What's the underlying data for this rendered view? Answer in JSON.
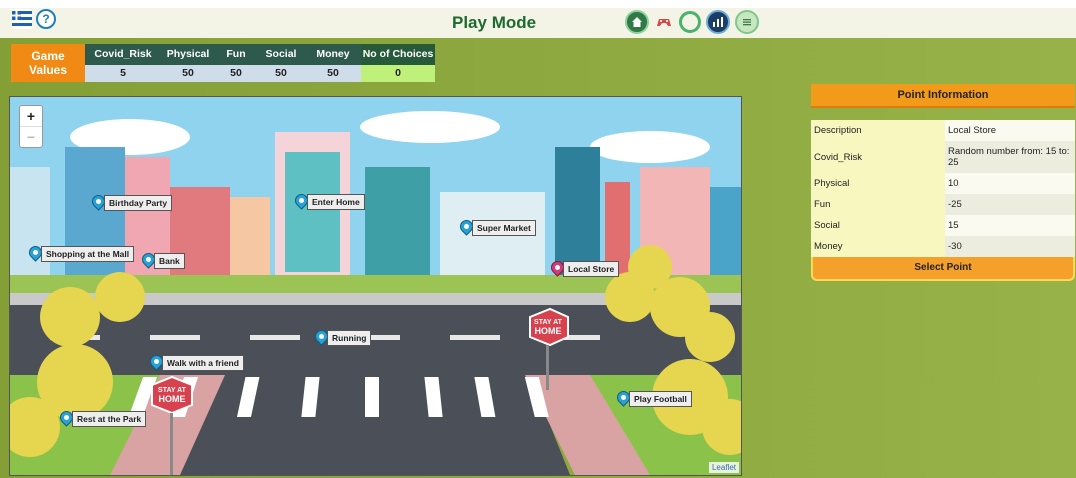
{
  "header": {
    "title": "Play Mode",
    "help_glyph": "?",
    "icons": [
      "language-icon",
      "help-icon",
      "home-icon",
      "game-icon",
      "refresh-icon",
      "stats-icon",
      "list-icon"
    ]
  },
  "game_values": {
    "label": "Game Values",
    "columns": [
      {
        "name": "Covid_Risk",
        "value": "5"
      },
      {
        "name": "Physical",
        "value": "50"
      },
      {
        "name": "Fun",
        "value": "50"
      },
      {
        "name": "Social",
        "value": "50"
      },
      {
        "name": "Money",
        "value": "50"
      },
      {
        "name": "No of Choices",
        "value": "0"
      }
    ]
  },
  "map": {
    "zoom_in": "+",
    "zoom_out": "−",
    "attribution": "Leaflet",
    "markers": [
      {
        "label": "Birthday Party"
      },
      {
        "label": "Enter Home"
      },
      {
        "label": "Super Market"
      },
      {
        "label": "Shopping at the Mall"
      },
      {
        "label": "Bank"
      },
      {
        "label": "Local Store",
        "selected": true
      },
      {
        "label": "Running"
      },
      {
        "label": "Walk with a friend"
      },
      {
        "label": "Rest at the Park"
      },
      {
        "label": "Play Football"
      }
    ],
    "signs": [
      "STAY AT",
      "HOME"
    ]
  },
  "point_info": {
    "title": "Point Information",
    "rows": [
      {
        "key": "Description",
        "value": "Local Store"
      },
      {
        "key": "Covid_Risk",
        "value": "Random number from: 15 to: 25"
      },
      {
        "key": "Physical",
        "value": "10"
      },
      {
        "key": "Fun",
        "value": "-25"
      },
      {
        "key": "Social",
        "value": "15"
      },
      {
        "key": "Money",
        "value": "-30"
      }
    ],
    "select_label": "Select Point"
  },
  "colors": {
    "accent": "#f29a1a",
    "title": "#1d6b2f",
    "background": "#8aa43a",
    "pin": "#2aa1d4",
    "pin_selected": "#d43a78"
  }
}
